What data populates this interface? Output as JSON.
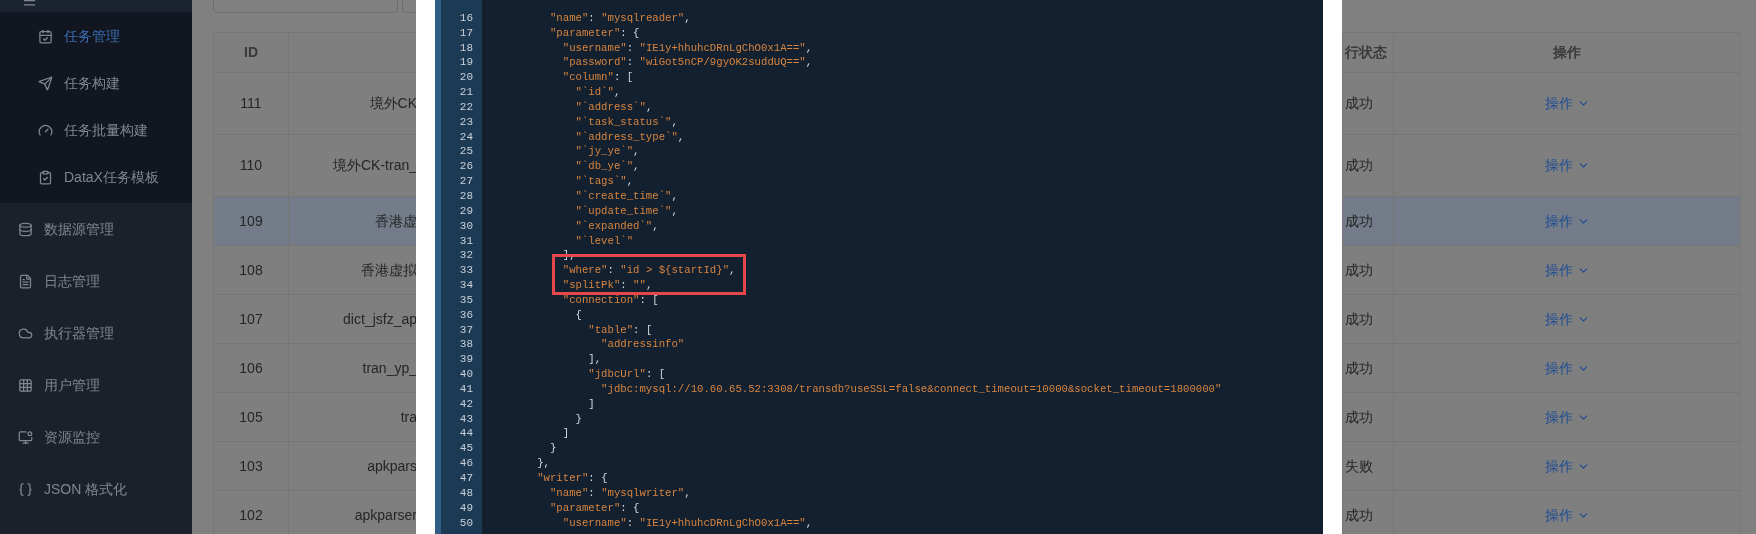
{
  "sidebar": {
    "submenu": [
      {
        "label": "任务管理",
        "selected": true
      },
      {
        "label": "任务构建",
        "selected": false
      },
      {
        "label": "任务批量构建",
        "selected": false
      },
      {
        "label": "DataX任务模板",
        "selected": false
      }
    ],
    "items": [
      {
        "label": "数据源管理"
      },
      {
        "label": "日志管理"
      },
      {
        "label": "执行器管理"
      },
      {
        "label": "用户管理"
      },
      {
        "label": "资源监控"
      },
      {
        "label": "JSON 格式化"
      }
    ]
  },
  "table": {
    "columns": {
      "id": "ID",
      "status": "行状态",
      "actions": "操作"
    },
    "rows": [
      {
        "id": "111",
        "name": "境外CK",
        "status": "成功",
        "action": "操作",
        "selected": false
      },
      {
        "id": "110",
        "name": "境外CK-tran_",
        "status": "成功",
        "action": "操作",
        "selected": false
      },
      {
        "id": "109",
        "name": "香港虚",
        "status": "成功",
        "action": "操作",
        "selected": true
      },
      {
        "id": "108",
        "name": "香港虚拟",
        "status": "成功",
        "action": "操作",
        "selected": false
      },
      {
        "id": "107",
        "name": "dict_jsfz_ap",
        "status": "成功",
        "action": "操作",
        "selected": false
      },
      {
        "id": "106",
        "name": "tran_yp_",
        "status": "成功",
        "action": "操作",
        "selected": false
      },
      {
        "id": "105",
        "name": "tra",
        "status": "成功",
        "action": "操作",
        "selected": false
      },
      {
        "id": "103",
        "name": "apkpars",
        "status": "失败",
        "action": "操作",
        "selected": false
      },
      {
        "id": "102",
        "name": "apkparser",
        "status": "成功",
        "action": "操作",
        "selected": false
      }
    ]
  },
  "dialog": {
    "code_before": [
      {
        "n": "16",
        "text": "          \"name\": \"mysqlreader\","
      },
      {
        "n": "17",
        "text": "          \"parameter\": {"
      },
      {
        "n": "18",
        "text": "            \"username\": \"IE1y+hhuhcDRnLgChO0x1A==\","
      },
      {
        "n": "19",
        "text": "            \"password\": \"wiGot5nCP/9gyOK2suddUQ==\","
      },
      {
        "n": "20",
        "text": "            \"column\": ["
      },
      {
        "n": "21",
        "text": "              \"`id`\","
      },
      {
        "n": "22",
        "text": "              \"`address`\","
      },
      {
        "n": "23",
        "text": "              \"`task_status`\","
      },
      {
        "n": "24",
        "text": "              \"`address_type`\","
      },
      {
        "n": "25",
        "text": "              \"`jy_ye`\","
      },
      {
        "n": "26",
        "text": "              \"`db_ye`\","
      },
      {
        "n": "27",
        "text": "              \"`tags`\","
      },
      {
        "n": "28",
        "text": "              \"`create_time`\","
      },
      {
        "n": "29",
        "text": "              \"`update_time`\","
      },
      {
        "n": "30",
        "text": "              \"`expanded`\","
      },
      {
        "n": "31",
        "text": "              \"`level`\""
      },
      {
        "n": "32",
        "text": "            ],"
      }
    ],
    "highlighted_lines": [
      {
        "n": "33",
        "text": "            \"where\": \"id > ${startId}\","
      },
      {
        "n": "34",
        "text": "            \"splitPk\": \"\","
      }
    ],
    "code_after": [
      {
        "n": "35",
        "text": "            \"connection\": ["
      },
      {
        "n": "36",
        "text": "              {"
      },
      {
        "n": "37",
        "text": "                \"table\": ["
      },
      {
        "n": "38",
        "text": "                  \"addressinfo\""
      },
      {
        "n": "39",
        "text": "                ],"
      },
      {
        "n": "40",
        "text": "                \"jdbcUrl\": ["
      },
      {
        "n": "41",
        "text": "                  \"jdbc:mysql://10.60.65.52:3308/transdb?useSSL=false&connect_timeout=10000&socket_timeout=1800000\""
      },
      {
        "n": "42",
        "text": "                ]"
      },
      {
        "n": "43",
        "text": "              }"
      },
      {
        "n": "44",
        "text": "            ]"
      },
      {
        "n": "45",
        "text": "          }"
      },
      {
        "n": "46",
        "text": "        },"
      },
      {
        "n": "47",
        "text": "        \"writer\": {"
      },
      {
        "n": "48",
        "text": "          \"name\": \"mysqlwriter\","
      },
      {
        "n": "49",
        "text": "          \"parameter\": {"
      },
      {
        "n": "50",
        "text": "            \"username\": \"IE1y+hhuhcDRnLgChO0x1A==\","
      }
    ]
  }
}
